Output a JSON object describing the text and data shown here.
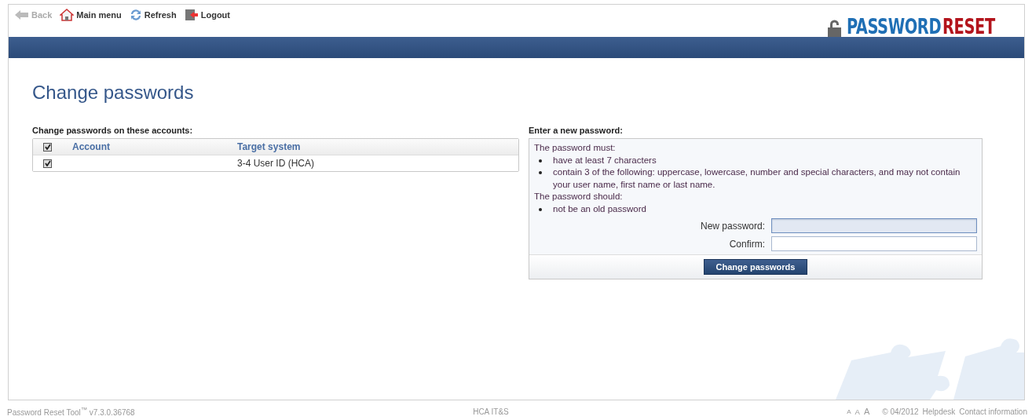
{
  "toolbar": [
    {
      "kind": "back",
      "label": "Back",
      "disabled": true
    },
    {
      "kind": "home",
      "label": "Main menu",
      "disabled": false
    },
    {
      "kind": "refresh",
      "label": "Refresh",
      "disabled": false
    },
    {
      "kind": "logout",
      "label": "Logout",
      "disabled": false
    }
  ],
  "logo": {
    "first": "PASSWORD",
    "second": "RESET"
  },
  "page_title": "Change passwords",
  "accounts": {
    "heading": "Change passwords on these accounts:",
    "columns": [
      {
        "label": "Account"
      },
      {
        "label": "Target system"
      }
    ],
    "header_checked": true,
    "rows": [
      {
        "checked": true,
        "target_system": "3-4 User ID (HCA)"
      }
    ]
  },
  "new_password": {
    "heading": "Enter a new password:",
    "rules": [
      {
        "kind": "heading",
        "text": "The password must:"
      },
      {
        "kind": "bullet",
        "text": "have at least 7 characters"
      },
      {
        "kind": "bullet",
        "text": "contain 3 of the following: uppercase, lowercase, number and special characters, and may not contain your user name, first name or last name."
      },
      {
        "kind": "heading",
        "text": "The password should:"
      },
      {
        "kind": "bullet",
        "text": "not be an old password"
      }
    ],
    "fields": [
      {
        "label": "New password:",
        "focused": true
      },
      {
        "label": "Confirm:",
        "focused": false
      }
    ],
    "submit": "Change passwords"
  },
  "footer": {
    "product": "Password Reset Tool$^{™}$ v7.3.0.36768",
    "center": "HCA IT&S",
    "font_sizes": [
      "A",
      "A",
      "A"
    ],
    "copyright": "© 04/2012",
    "links": [
      "Helpdesk",
      "Contact information"
    ]
  }
}
